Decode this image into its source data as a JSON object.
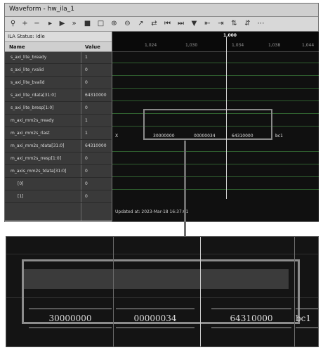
{
  "window": {
    "title": "Waveform - hw_ila_1"
  },
  "toolbar": {
    "icons": [
      "search-icon",
      "zoom-in-icon",
      "zoom-out-icon",
      "play-icon",
      "play-icon",
      "fast-forward-icon",
      "stop-icon",
      "fit-icon",
      "zoom-in-icon",
      "zoom-out-icon",
      "expand-icon",
      "swap-icon",
      "goto-start-icon",
      "goto-end-icon",
      "add-marker-icon",
      "prev-marker-icon",
      "next-marker-icon",
      "snap-icon",
      "sort-icon",
      "settings-icon"
    ]
  },
  "left_pane": {
    "status": "ILA Status: Idle",
    "column_name": "Name",
    "column_value": "Value",
    "signals": [
      {
        "name": "s_axi_lite_bready",
        "value": "1"
      },
      {
        "name": "s_axi_lite_rvalid",
        "value": "0"
      },
      {
        "name": "s_axi_lite_bvalid",
        "value": "0"
      },
      {
        "name": "s_axi_lite_rdata[31:0]",
        "value": "64310000"
      },
      {
        "name": "s_axi_lite_bresp[1:0]",
        "value": "0"
      },
      {
        "name": "m_axi_mm2s_rready",
        "value": "1"
      },
      {
        "name": "m_axi_mm2s_rlast",
        "value": "1"
      },
      {
        "name": "m_axi_mm2s_rdata[31:0]",
        "value": "64310000"
      },
      {
        "name": "m_axi_mm2s_rresp[1:0]",
        "value": "0"
      },
      {
        "name": "m_axis_mm2s_tdata[31:0]",
        "value": "0"
      },
      {
        "name": "[0]",
        "value": "0"
      },
      {
        "name": "[1]",
        "value": "0"
      }
    ]
  },
  "waveform": {
    "cursor_label": "1,000",
    "ticks": [
      "1,024",
      "1,030",
      "1,034",
      "1,038",
      "1,044"
    ],
    "bus_values": [
      "X",
      "30000000",
      "00000034",
      "64310000",
      "bc1"
    ],
    "footer": "Updated at: 2023-Mar-18 16:37:01"
  },
  "zoom": {
    "bus_values": [
      "30000000",
      "00000034",
      "64310000",
      "bc1"
    ]
  }
}
